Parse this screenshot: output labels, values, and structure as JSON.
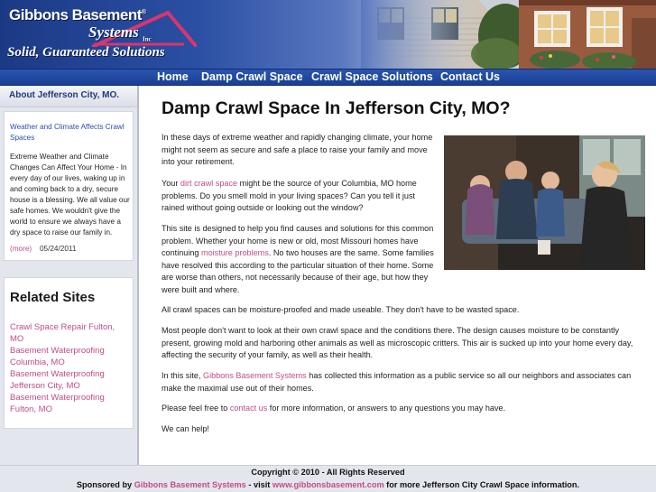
{
  "header": {
    "logo_line1": "Gibbons Basement",
    "logo_registered": "®",
    "logo_line2": "Systems",
    "logo_inc": "Inc",
    "tagline": "Solid, Guaranteed Solutions"
  },
  "nav": {
    "items": [
      {
        "label": "Home"
      },
      {
        "label": "Damp Crawl Space"
      },
      {
        "label": "Crawl Space Solutions"
      },
      {
        "label": "Contact Us"
      }
    ]
  },
  "sidebar": {
    "about_heading": "About Jefferson City, MO.",
    "article_link": "Weather and Climate Affects Crawl Spaces",
    "article_text": "Extreme Weather and Climate Changes Can Affect Your Home - In every day of our lives, waking up in and coming back to a dry, secure house is a blessing. We all value our safe homes. We wouldn't give the world to ensure we always have a dry space to raise our family in.",
    "more_label": "(more)",
    "article_date": "05/24/2011",
    "related_title": "Related Sites",
    "related_links": [
      "Crawl Space Repair Fulton, MO",
      "Basement Waterproofing Columbia, MO",
      "Basement Waterproofing Jefferson City, MO",
      "Basement Waterproofing Fulton, MO"
    ]
  },
  "main": {
    "title": "Damp Crawl Space In Jefferson City, MO?",
    "p1": "In these days of extreme weather and rapidly changing climate, your home might not seem as secure and safe a place to raise your family and move into your retirement.",
    "p2_pre": "Your ",
    "p2_link": "dirt crawl space",
    "p2_post": " might be the source of your Columbia, MO home problems. Do you smell mold in your living spaces? Can you tell it just rained without going outside or looking out the window?",
    "p3_pre": "This site is designed to help you find causes and solutions for this common problem. Whether your home is new or old, most Missouri homes have continuing ",
    "p3_link": "moisture problems",
    "p3_post": ". No two houses are the same. Some families have resolved this according to the particular situation of their home. Some are worse than others, not necessarily because of their age, but how they were built and where.",
    "p4": "All crawl spaces can be moisture-proofed and made useable. They don't have to be wasted space.",
    "p5": "Most people don't want to look at their own crawl space and the conditions there. The design causes moisture to be constantly present, growing mold and harboring other animals as well as microscopic critters. This air is sucked up into your home every day, affecting the security of your family, as well as their health.",
    "p6_pre": "In this site, ",
    "p6_link": "Gibbons Basement Systems",
    "p6_post": " has collected this information as a public service so all our neighbors and associates can make the maximal use out of their homes.",
    "p7_pre": "Please feel free to ",
    "p7_link": "contact us",
    "p7_post": " for more information, or answers to any questions you may have.",
    "p8": "We can help!"
  },
  "footer": {
    "copyright": "Copyright © 2010 - All Rights Reserved",
    "sponsor_pre": "Sponsored by ",
    "sponsor_link": "Gibbons Basement Systems",
    "sponsor_mid": " - visit ",
    "sponsor_url": "www.gibbonsbasement.com",
    "sponsor_post": " for more Jefferson City Crawl Space information."
  }
}
